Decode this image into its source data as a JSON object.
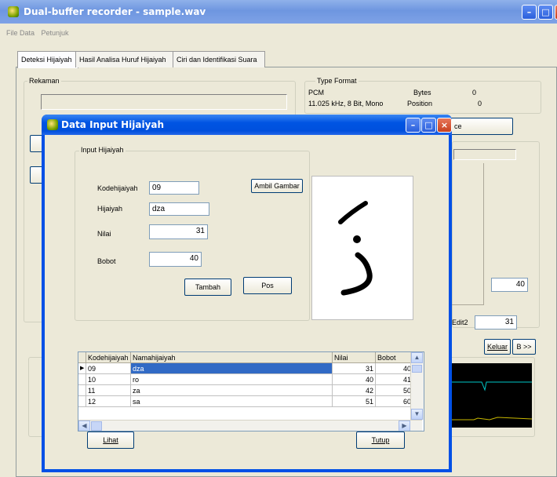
{
  "window": {
    "title": "Dual-buffer recorder - sample.wav"
  },
  "menu": {
    "items": [
      "File Data",
      "Petunjuk"
    ]
  },
  "tabs": [
    {
      "label": "Deteksi Hijaiyah"
    },
    {
      "label": "Hasil Analisa Huruf Hijaiyah"
    },
    {
      "label": "Ciri dan Identifikasi Suara"
    }
  ],
  "rekaman": {
    "label": "Rekaman"
  },
  "type_format": {
    "label": "Type Format",
    "format": "PCM",
    "rate": "11.025 kHz, 8 Bit, Mono",
    "bytes_label": "Bytes",
    "bytes_value": "0",
    "position_label": "Position",
    "position_value": "0"
  },
  "background": {
    "button_partial": "ce",
    "field_value_1": "40",
    "edit2_label": "Edit2",
    "edit2_value": "31",
    "keluar_label": "Keluar",
    "next_label": "B >>"
  },
  "dialog": {
    "title": "Data Input Hijaiyah",
    "group_label": "Input Hijaiyah",
    "kode_label": "Kodehijaiyah",
    "kode_value": "09",
    "hijaiyah_label": "Hijaiyah",
    "hijaiyah_value": "dza",
    "nilai_label": "Nilai",
    "nilai_value": "31",
    "bobot_label": "Bobot",
    "bobot_value": "40",
    "ambil_gambar_label": "Ambil Gambar",
    "tambah_label": "Tambah",
    "pos_label": "Pos",
    "lihat_label": "Lihat",
    "tutup_label": "Tutup"
  },
  "grid": {
    "columns": [
      "Kodehijaiyah",
      "Namahijaiyah",
      "Nilai",
      "Bobot"
    ],
    "rows": [
      {
        "kode": "09",
        "nama": "dza",
        "nilai": "31",
        "bobot": "40"
      },
      {
        "kode": "10",
        "nama": "ro",
        "nilai": "40",
        "bobot": "41"
      },
      {
        "kode": "11",
        "nama": "za",
        "nilai": "42",
        "bobot": "50"
      },
      {
        "kode": "12",
        "nama": "sa",
        "nilai": "51",
        "bobot": "60"
      }
    ]
  },
  "colors": {
    "titlebar": "#0054e3",
    "selection": "#316ac5",
    "scope_bg": "#000000",
    "trace": "#00c8c8"
  }
}
